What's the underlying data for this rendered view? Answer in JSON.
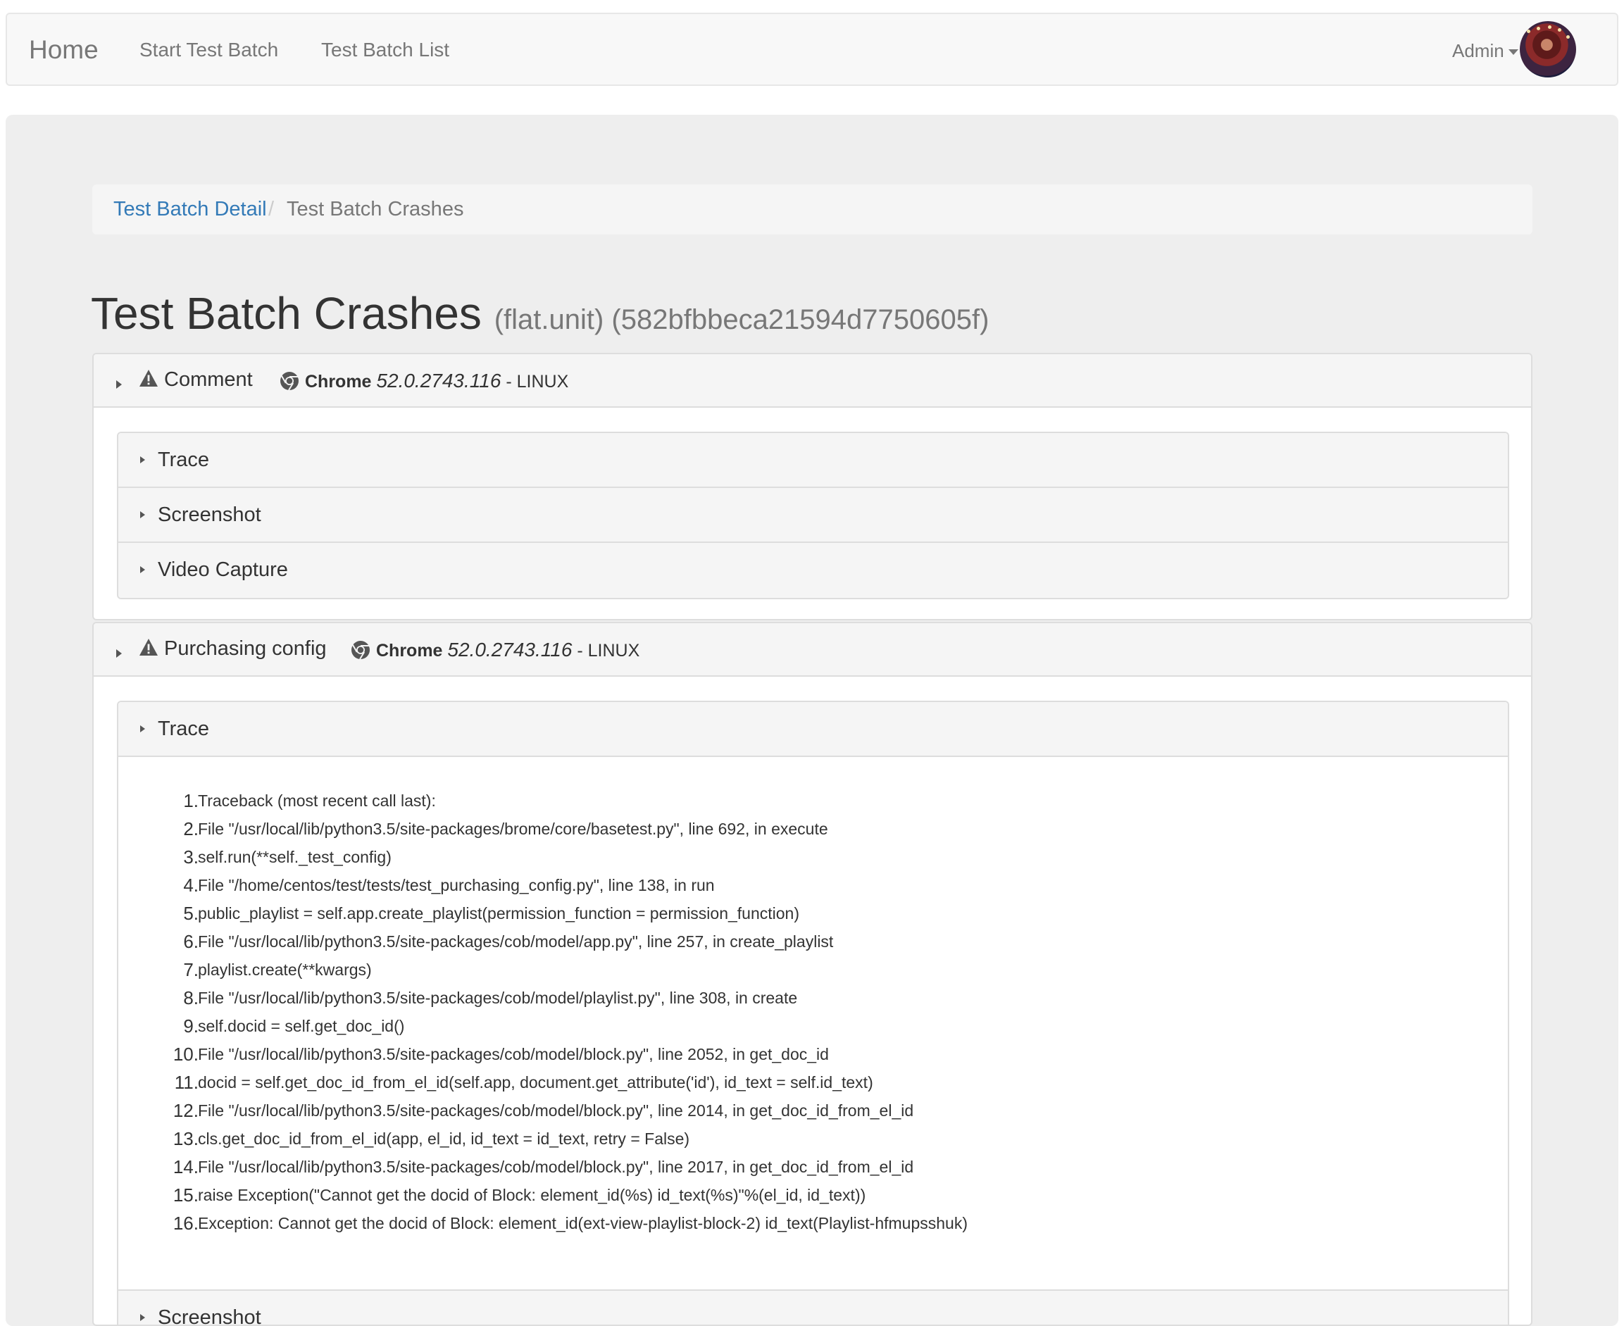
{
  "navbar": {
    "brand": "Home",
    "links": [
      "Start Test Batch",
      "Test Batch List"
    ],
    "user": "Admin"
  },
  "breadcrumb": {
    "parent": "Test Batch Detail",
    "separator": "/",
    "current": "Test Batch Crashes"
  },
  "page": {
    "title": "Test Batch Crashes",
    "subtitle": "(flat.unit) (582bfbbeca21594d7750605f)"
  },
  "crashes": [
    {
      "name": "Comment",
      "browser_name": "Chrome",
      "browser_version": "52.0.2743.116",
      "platform": "- LINUX",
      "sections": [
        "Trace",
        "Screenshot",
        "Video Capture"
      ]
    },
    {
      "name": "Purchasing config",
      "browser_name": "Chrome",
      "browser_version": "52.0.2743.116",
      "platform": "- LINUX",
      "sections": [
        "Trace",
        "Screenshot"
      ],
      "trace": [
        "Traceback (most recent call last):",
        "File \"/usr/local/lib/python3.5/site-packages/brome/core/basetest.py\", line 692, in execute",
        "self.run(**self._test_config)",
        "File \"/home/centos/test/tests/test_purchasing_config.py\", line 138, in run",
        "public_playlist = self.app.create_playlist(permission_function = permission_function)",
        "File \"/usr/local/lib/python3.5/site-packages/cob/model/app.py\", line 257, in create_playlist",
        "playlist.create(**kwargs)",
        "File \"/usr/local/lib/python3.5/site-packages/cob/model/playlist.py\", line 308, in create",
        "self.docid = self.get_doc_id()",
        "File \"/usr/local/lib/python3.5/site-packages/cob/model/block.py\", line 2052, in get_doc_id",
        "docid = self.get_doc_id_from_el_id(self.app, document.get_attribute('id'), id_text = self.id_text)",
        "File \"/usr/local/lib/python3.5/site-packages/cob/model/block.py\", line 2014, in get_doc_id_from_el_id",
        "cls.get_doc_id_from_el_id(app, el_id, id_text = id_text, retry = False)",
        "File \"/usr/local/lib/python3.5/site-packages/cob/model/block.py\", line 2017, in get_doc_id_from_el_id",
        "raise Exception(\"Cannot get the docid of Block: element_id(%s) id_text(%s)\"%(el_id, id_text))",
        "Exception: Cannot get the docid of Block: element_id(ext-view-playlist-block-2) id_text(Playlist-hfmupsshuk)"
      ]
    }
  ],
  "icons": {
    "warning": "warning-icon",
    "browser": "chrome-icon",
    "expand": "caret-right-icon",
    "user_menu": "caret-down-icon"
  },
  "colors": {
    "link": "#337ab7",
    "navbar_bg": "#f8f8f8",
    "jumbotron_bg": "#eeeeee",
    "panel_heading_bg": "#f5f5f5",
    "muted_text": "#777777"
  }
}
